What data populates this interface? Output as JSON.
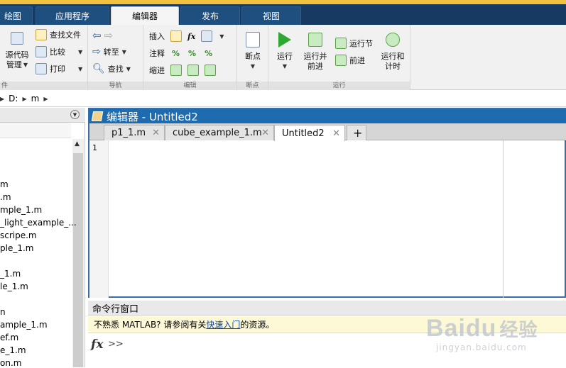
{
  "tabs": [
    {
      "label": "绘图"
    },
    {
      "label": "应用程序"
    },
    {
      "label": "编辑器",
      "active": true
    },
    {
      "label": "发布"
    },
    {
      "label": "视图"
    }
  ],
  "ribbon": {
    "file": {
      "source_control": "源代码",
      "manage": "管理",
      "find_files": "查找文件",
      "compare": "比较",
      "print": "打印",
      "label": "件"
    },
    "navigate": {
      "goto": "转至",
      "find": "查找",
      "label": "导航"
    },
    "edit": {
      "insert": "插入",
      "comment": "注释",
      "indent": "缩进",
      "label": "编辑"
    },
    "breakpoints": {
      "breakpoints": "断点",
      "label": "断点"
    },
    "run": {
      "run": "运行",
      "run_and_advance_1": "运行并",
      "run_and_advance_2": "前进",
      "run_section": "运行节",
      "advance": "前进",
      "run_and_time_1": "运行和",
      "run_and_time_2": "计时",
      "label": "运行"
    }
  },
  "address": {
    "drive": "D:",
    "folder": "m"
  },
  "files": [
    "m",
    ".m",
    "mple_1.m",
    "_light_example_...",
    "scripe.m",
    "ple_1.m",
    "_1.m",
    "le_1.m",
    "n",
    "ample_1.m",
    "ef.m",
    "e_1.m",
    "on.m"
  ],
  "editor": {
    "title": "编辑器 - Untitled2",
    "tabs": [
      {
        "label": "p1_1.m"
      },
      {
        "label": "cube_example_1.m"
      },
      {
        "label": "Untitled2",
        "active": true
      }
    ],
    "add_tab": "+",
    "line_number": "1"
  },
  "command": {
    "title": "命令行窗口",
    "notice_prefix": "不熟悉 MATLAB? 请参阅有关",
    "notice_link": "快速入门",
    "notice_suffix": "的资源。",
    "fx": "fx",
    "prompt": ">>"
  },
  "watermark": {
    "brand": "Baidu",
    "jingyan": "经验",
    "url": "jingyan.baidu.com"
  },
  "colors": {
    "tabbar": "#173a63",
    "editor_title": "#1e6bb0",
    "notice_bg": "#fdf8d5"
  }
}
